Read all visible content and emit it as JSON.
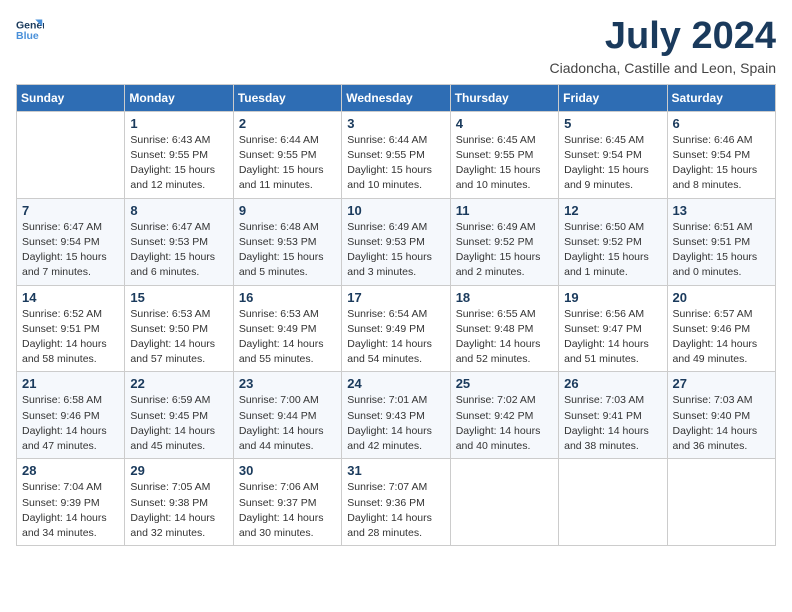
{
  "logo": {
    "line1": "General",
    "line2": "Blue"
  },
  "title": "July 2024",
  "subtitle": "Ciadoncha, Castille and Leon, Spain",
  "weekdays": [
    "Sunday",
    "Monday",
    "Tuesday",
    "Wednesday",
    "Thursday",
    "Friday",
    "Saturday"
  ],
  "weeks": [
    [
      {
        "day": "",
        "info": ""
      },
      {
        "day": "1",
        "info": "Sunrise: 6:43 AM\nSunset: 9:55 PM\nDaylight: 15 hours\nand 12 minutes."
      },
      {
        "day": "2",
        "info": "Sunrise: 6:44 AM\nSunset: 9:55 PM\nDaylight: 15 hours\nand 11 minutes."
      },
      {
        "day": "3",
        "info": "Sunrise: 6:44 AM\nSunset: 9:55 PM\nDaylight: 15 hours\nand 10 minutes."
      },
      {
        "day": "4",
        "info": "Sunrise: 6:45 AM\nSunset: 9:55 PM\nDaylight: 15 hours\nand 10 minutes."
      },
      {
        "day": "5",
        "info": "Sunrise: 6:45 AM\nSunset: 9:54 PM\nDaylight: 15 hours\nand 9 minutes."
      },
      {
        "day": "6",
        "info": "Sunrise: 6:46 AM\nSunset: 9:54 PM\nDaylight: 15 hours\nand 8 minutes."
      }
    ],
    [
      {
        "day": "7",
        "info": "Sunrise: 6:47 AM\nSunset: 9:54 PM\nDaylight: 15 hours\nand 7 minutes."
      },
      {
        "day": "8",
        "info": "Sunrise: 6:47 AM\nSunset: 9:53 PM\nDaylight: 15 hours\nand 6 minutes."
      },
      {
        "day": "9",
        "info": "Sunrise: 6:48 AM\nSunset: 9:53 PM\nDaylight: 15 hours\nand 5 minutes."
      },
      {
        "day": "10",
        "info": "Sunrise: 6:49 AM\nSunset: 9:53 PM\nDaylight: 15 hours\nand 3 minutes."
      },
      {
        "day": "11",
        "info": "Sunrise: 6:49 AM\nSunset: 9:52 PM\nDaylight: 15 hours\nand 2 minutes."
      },
      {
        "day": "12",
        "info": "Sunrise: 6:50 AM\nSunset: 9:52 PM\nDaylight: 15 hours\nand 1 minute."
      },
      {
        "day": "13",
        "info": "Sunrise: 6:51 AM\nSunset: 9:51 PM\nDaylight: 15 hours\nand 0 minutes."
      }
    ],
    [
      {
        "day": "14",
        "info": "Sunrise: 6:52 AM\nSunset: 9:51 PM\nDaylight: 14 hours\nand 58 minutes."
      },
      {
        "day": "15",
        "info": "Sunrise: 6:53 AM\nSunset: 9:50 PM\nDaylight: 14 hours\nand 57 minutes."
      },
      {
        "day": "16",
        "info": "Sunrise: 6:53 AM\nSunset: 9:49 PM\nDaylight: 14 hours\nand 55 minutes."
      },
      {
        "day": "17",
        "info": "Sunrise: 6:54 AM\nSunset: 9:49 PM\nDaylight: 14 hours\nand 54 minutes."
      },
      {
        "day": "18",
        "info": "Sunrise: 6:55 AM\nSunset: 9:48 PM\nDaylight: 14 hours\nand 52 minutes."
      },
      {
        "day": "19",
        "info": "Sunrise: 6:56 AM\nSunset: 9:47 PM\nDaylight: 14 hours\nand 51 minutes."
      },
      {
        "day": "20",
        "info": "Sunrise: 6:57 AM\nSunset: 9:46 PM\nDaylight: 14 hours\nand 49 minutes."
      }
    ],
    [
      {
        "day": "21",
        "info": "Sunrise: 6:58 AM\nSunset: 9:46 PM\nDaylight: 14 hours\nand 47 minutes."
      },
      {
        "day": "22",
        "info": "Sunrise: 6:59 AM\nSunset: 9:45 PM\nDaylight: 14 hours\nand 45 minutes."
      },
      {
        "day": "23",
        "info": "Sunrise: 7:00 AM\nSunset: 9:44 PM\nDaylight: 14 hours\nand 44 minutes."
      },
      {
        "day": "24",
        "info": "Sunrise: 7:01 AM\nSunset: 9:43 PM\nDaylight: 14 hours\nand 42 minutes."
      },
      {
        "day": "25",
        "info": "Sunrise: 7:02 AM\nSunset: 9:42 PM\nDaylight: 14 hours\nand 40 minutes."
      },
      {
        "day": "26",
        "info": "Sunrise: 7:03 AM\nSunset: 9:41 PM\nDaylight: 14 hours\nand 38 minutes."
      },
      {
        "day": "27",
        "info": "Sunrise: 7:03 AM\nSunset: 9:40 PM\nDaylight: 14 hours\nand 36 minutes."
      }
    ],
    [
      {
        "day": "28",
        "info": "Sunrise: 7:04 AM\nSunset: 9:39 PM\nDaylight: 14 hours\nand 34 minutes."
      },
      {
        "day": "29",
        "info": "Sunrise: 7:05 AM\nSunset: 9:38 PM\nDaylight: 14 hours\nand 32 minutes."
      },
      {
        "day": "30",
        "info": "Sunrise: 7:06 AM\nSunset: 9:37 PM\nDaylight: 14 hours\nand 30 minutes."
      },
      {
        "day": "31",
        "info": "Sunrise: 7:07 AM\nSunset: 9:36 PM\nDaylight: 14 hours\nand 28 minutes."
      },
      {
        "day": "",
        "info": ""
      },
      {
        "day": "",
        "info": ""
      },
      {
        "day": "",
        "info": ""
      }
    ]
  ]
}
